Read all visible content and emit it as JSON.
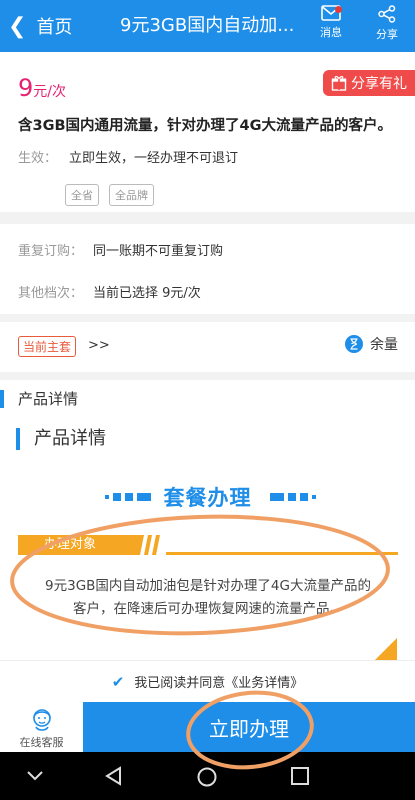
{
  "header": {
    "back_label": "首页",
    "title": "9元3GB国内自动加...",
    "message_label": "消息",
    "share_label": "分享"
  },
  "product": {
    "price": "9",
    "price_unit": "元/次",
    "gift_label": "分享有礼",
    "description": "含3GB国内通用流量，针对办理了4G大流量产品的客户。",
    "effect_label": "生效：",
    "effect_value": "立即生效，一经办理不可退订",
    "tags": [
      "全省",
      "全品牌"
    ]
  },
  "info": {
    "repeat_label": "重复订购：",
    "repeat_value": "同一账期不可重复订购",
    "other_label": "其他档次：",
    "other_value": "当前已选择 9元/次"
  },
  "current_plan": {
    "tag": "当前主套",
    "arrows": ">>",
    "balance_label": "余量"
  },
  "details": {
    "section_title": "产品详情",
    "inner_title": "产品详情",
    "banner_title": "套餐办理",
    "target_label": "办理对象",
    "target_text_1": "9元3GB国内自动加油包是针对办理了4G大流量产品的",
    "target_text_2": "客户，在降速后可办理恢复网速的流量产品。"
  },
  "agreement": {
    "prefix": "我已阅读并同意",
    "link": "《业务详情》"
  },
  "bottom": {
    "service_label": "在线客服",
    "apply_label": "立即办理"
  },
  "colors": {
    "primary": "#1e8ee8",
    "price": "#e6216f",
    "accent": "#f5a623",
    "annotation": "#f0a065"
  }
}
